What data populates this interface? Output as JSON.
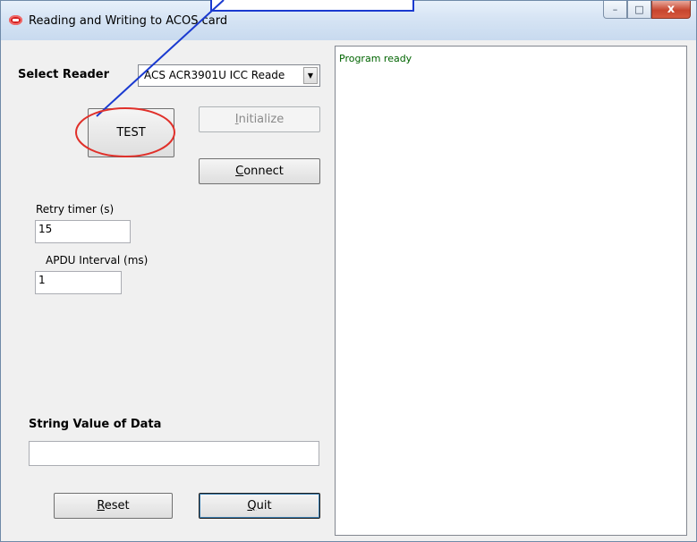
{
  "window": {
    "title": "Reading and Writing to ACOS card",
    "controls": {
      "minimize": "–",
      "maximize": "□",
      "close": "x"
    }
  },
  "reader": {
    "label": "Select Reader",
    "selected": "ACS ACR3901U ICC Reade"
  },
  "buttons": {
    "test": "TEST",
    "initialize": "Initialize",
    "connect": "Connect",
    "reset": "Reset",
    "quit": "Quit"
  },
  "retry": {
    "label": "Retry timer (s)",
    "value": "15"
  },
  "apdu": {
    "label": "APDU Interval (ms)",
    "value": "1"
  },
  "string_data": {
    "label": "String Value of Data",
    "value": ""
  },
  "log": {
    "text": "Program ready"
  },
  "colors": {
    "annotation_red": "#e0302a",
    "annotation_blue": "#1a3ad0"
  }
}
